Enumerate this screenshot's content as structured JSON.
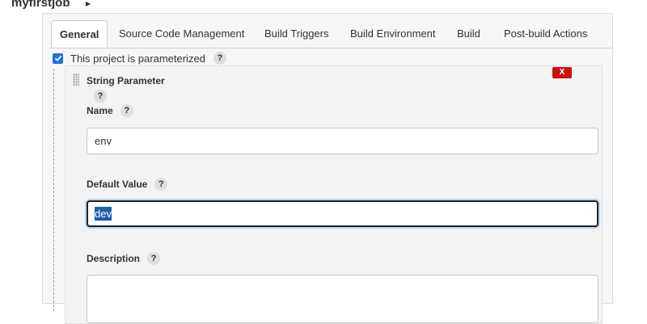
{
  "breadcrumb": {
    "job_name": "myfirstjob"
  },
  "tabs": [
    {
      "label": "General"
    },
    {
      "label": "Source Code Management"
    },
    {
      "label": "Build Triggers"
    },
    {
      "label": "Build Environment"
    },
    {
      "label": "Build"
    },
    {
      "label": "Post-build Actions"
    }
  ],
  "parameterized": {
    "label": "This project is parameterized",
    "checked": true,
    "help": "?"
  },
  "parameter": {
    "type_label": "String Parameter",
    "delete_label": "X",
    "help": "?",
    "name": {
      "label": "Name",
      "value": "env",
      "help": "?"
    },
    "default_value": {
      "label": "Default Value",
      "value": "dev",
      "help": "?"
    },
    "description": {
      "label": "Description",
      "value": "",
      "help": "?"
    }
  },
  "colors": {
    "checkbox": "#1a73e8",
    "delete": "#cc1111",
    "selection": "#1e5fae"
  }
}
